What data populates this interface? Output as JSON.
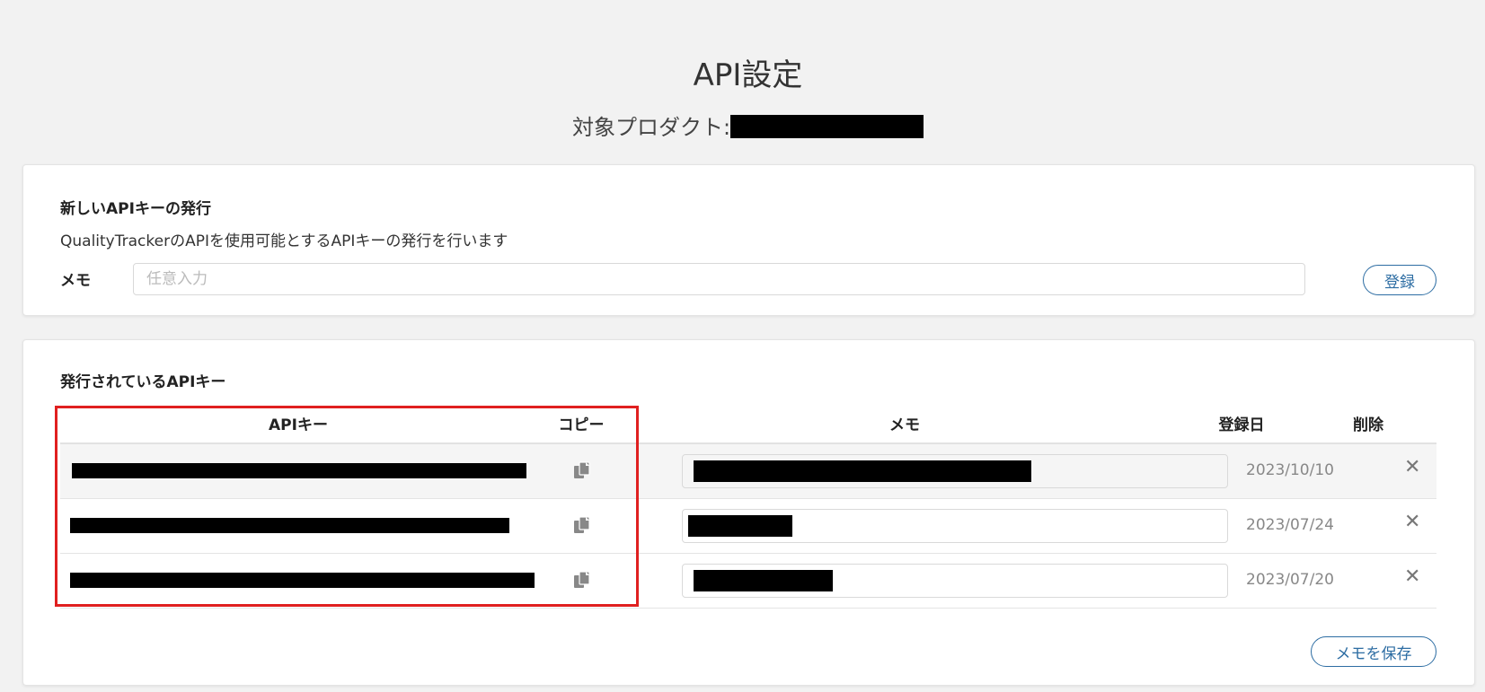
{
  "page": {
    "title": "API設定",
    "product_label": "対象プロダクト:"
  },
  "new_key": {
    "heading": "新しいAPIキーの発行",
    "description": "QualityTrackerのAPIを使用可能とするAPIキーの発行を行います",
    "memo_label": "メモ",
    "memo_placeholder": "任意入力",
    "memo_value": "",
    "register_label": "登録"
  },
  "issued_keys": {
    "heading": "発行されているAPIキー",
    "columns": {
      "key": "APIキー",
      "copy": "コピー",
      "memo": "メモ",
      "date": "登録日",
      "delete": "削除"
    },
    "rows": [
      {
        "date": "2023/10/10",
        "delete_glyph": "✕",
        "copy_icon": "copy-icon"
      },
      {
        "date": "2023/07/24",
        "delete_glyph": "✕",
        "copy_icon": "copy-icon"
      },
      {
        "date": "2023/07/20",
        "delete_glyph": "✕",
        "copy_icon": "copy-icon"
      }
    ],
    "save_memo_label": "メモを保存"
  },
  "colors": {
    "background": "#f2f2f2",
    "accent": "#2d6da3",
    "highlight": "#e02020",
    "redaction": "#000000"
  }
}
